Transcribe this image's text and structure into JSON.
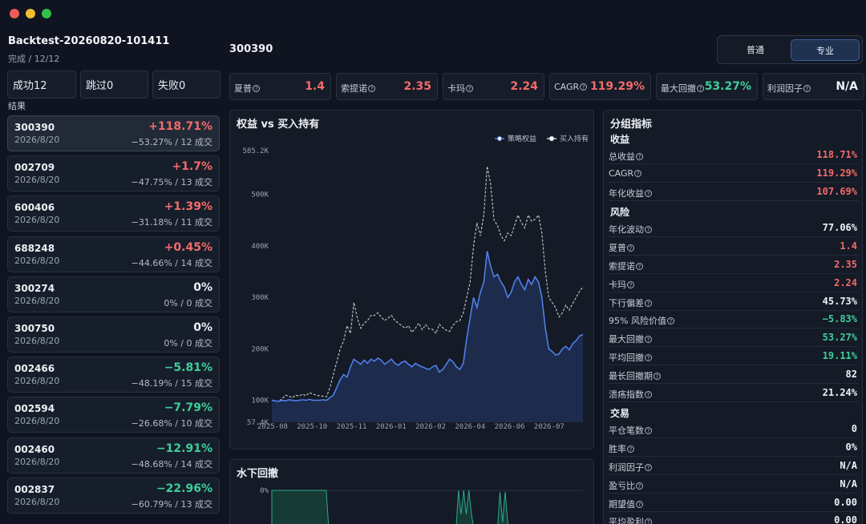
{
  "window": {
    "dots": [
      "#ee5c57",
      "#f2bd2f",
      "#32c048"
    ]
  },
  "sidebar": {
    "title": "Backtest-20260820-101411",
    "status": "完成 / 12/12",
    "stats": [
      {
        "label": "成功",
        "value": "12"
      },
      {
        "label": "跳过",
        "value": "0"
      },
      {
        "label": "失败",
        "value": "0"
      }
    ],
    "results_label": "结果",
    "results": [
      {
        "code": "300390",
        "date": "2026/8/20",
        "pct": "+118.71%",
        "sub": "−53.27% / 12 成交",
        "tone": "pos"
      },
      {
        "code": "002709",
        "date": "2026/8/20",
        "pct": "+1.7%",
        "sub": "−47.75% / 13 成交",
        "tone": "pos"
      },
      {
        "code": "600406",
        "date": "2026/8/20",
        "pct": "+1.39%",
        "sub": "−31.18% / 11 成交",
        "tone": "pos"
      },
      {
        "code": "688248",
        "date": "2026/8/20",
        "pct": "+0.45%",
        "sub": "−44.66% / 14 成交",
        "tone": "pos"
      },
      {
        "code": "300274",
        "date": "2026/8/20",
        "pct": "0%",
        "sub": "0% / 0 成交",
        "tone": "neu"
      },
      {
        "code": "300750",
        "date": "2026/8/20",
        "pct": "0%",
        "sub": "0% / 0 成交",
        "tone": "neu"
      },
      {
        "code": "002466",
        "date": "2026/8/20",
        "pct": "−5.81%",
        "sub": "−48.19% / 15 成交",
        "tone": "neg"
      },
      {
        "code": "002594",
        "date": "2026/8/20",
        "pct": "−7.79%",
        "sub": "−26.68% / 10 成交",
        "tone": "neg"
      },
      {
        "code": "002460",
        "date": "2026/8/20",
        "pct": "−12.91%",
        "sub": "−48.68% / 14 成交",
        "tone": "neg"
      },
      {
        "code": "002837",
        "date": "2026/8/20",
        "pct": "−22.96%",
        "sub": "−60.79% / 13 成交",
        "tone": "neg"
      }
    ]
  },
  "main": {
    "title": "300390",
    "modes": [
      "普通",
      "专业"
    ],
    "active_mode": "专业",
    "metrics": [
      {
        "label": "夏普",
        "value": "1.4",
        "tone": "pos"
      },
      {
        "label": "索提诺",
        "value": "2.35",
        "tone": "pos"
      },
      {
        "label": "卡玛",
        "value": "2.24",
        "tone": "pos"
      },
      {
        "label": "CAGR",
        "value": "119.29%",
        "tone": "pos"
      },
      {
        "label": "最大回撤",
        "value": "53.27%",
        "tone": "neg"
      },
      {
        "label": "利润因子",
        "value": "N/A",
        "tone": "neu"
      }
    ],
    "equity_chart_title": "权益 vs 买入持有",
    "drawdown_chart_title": "水下回撤"
  },
  "chart_data": [
    {
      "type": "line",
      "title": "权益 vs 买入持有",
      "legend": [
        "策略权益",
        "买入持有"
      ],
      "legend_position": "top-right",
      "y_ticks": [
        "585.2K",
        "500K",
        "400K",
        "300K",
        "200K",
        "100K",
        "57.4K"
      ],
      "ylim": [
        57400,
        585200
      ],
      "x_ticks": [
        "2025-08",
        "2025-10",
        "2025-11",
        "2026-01",
        "2026-02",
        "2026-04",
        "2026-06",
        "2026-07"
      ],
      "x_tick_pos": [
        0,
        0.127,
        0.254,
        0.381,
        0.508,
        0.635,
        0.762,
        0.889
      ],
      "colors": {
        "strategy": "#4f7fe8",
        "buyhold": "#c8ccd4"
      },
      "series": [
        {
          "name": "策略权益",
          "values": [
            100000,
            99000,
            98000,
            100000,
            99000,
            101000,
            100000,
            99000,
            100000,
            101000,
            100000,
            102000,
            100000,
            100000,
            100000,
            101000,
            100000,
            105000,
            110000,
            125000,
            140000,
            150000,
            145000,
            165000,
            180000,
            175000,
            170000,
            178000,
            172000,
            180000,
            176000,
            182000,
            178000,
            170000,
            175000,
            180000,
            172000,
            168000,
            174000,
            176000,
            170000,
            165000,
            172000,
            168000,
            165000,
            162000,
            160000,
            165000,
            168000,
            155000,
            160000,
            170000,
            180000,
            175000,
            165000,
            160000,
            172000,
            220000,
            260000,
            300000,
            280000,
            310000,
            330000,
            390000,
            360000,
            340000,
            345000,
            330000,
            320000,
            300000,
            310000,
            330000,
            340000,
            325000,
            315000,
            335000,
            325000,
            340000,
            330000,
            300000,
            240000,
            200000,
            195000,
            188000,
            190000,
            200000,
            205000,
            198000,
            210000,
            216000,
            225000,
            228000
          ]
        },
        {
          "name": "买入持有",
          "values": [
            100000,
            99000,
            98000,
            103000,
            110000,
            108000,
            105000,
            110000,
            108000,
            112000,
            109000,
            115000,
            112000,
            110000,
            109000,
            108000,
            107000,
            125000,
            150000,
            175000,
            200000,
            215000,
            245000,
            230000,
            290000,
            260000,
            240000,
            250000,
            255000,
            265000,
            265000,
            270000,
            262000,
            255000,
            260000,
            265000,
            255000,
            250000,
            245000,
            240000,
            245000,
            232000,
            240000,
            250000,
            237000,
            247000,
            239000,
            238000,
            230000,
            248000,
            241000,
            236000,
            234000,
            246000,
            253000,
            255000,
            270000,
            300000,
            330000,
            400000,
            445000,
            420000,
            460000,
            555000,
            520000,
            450000,
            440000,
            420000,
            410000,
            425000,
            420000,
            440000,
            460000,
            445000,
            435000,
            460000,
            448000,
            452000,
            460000,
            425000,
            350000,
            300000,
            290000,
            280000,
            262000,
            270000,
            285000,
            275000,
            288000,
            300000,
            312000,
            320000
          ]
        }
      ]
    },
    {
      "type": "area",
      "title": "水下回撤",
      "y_ticks": [
        "0%"
      ],
      "colors": {
        "drawdown": "#2ea88a"
      }
    }
  ],
  "groups": {
    "title": "分组指标",
    "sections": [
      {
        "name": "收益",
        "rows": [
          {
            "label": "总收益",
            "value": "118.71%",
            "tone": "pos"
          },
          {
            "label": "CAGR",
            "value": "119.29%",
            "tone": "pos"
          },
          {
            "label": "年化收益",
            "value": "107.69%",
            "tone": "pos"
          }
        ]
      },
      {
        "name": "风险",
        "rows": [
          {
            "label": "年化波动",
            "value": "77.06%",
            "tone": "neu"
          },
          {
            "label": "夏普",
            "value": "1.4",
            "tone": "pos"
          },
          {
            "label": "索提诺",
            "value": "2.35",
            "tone": "pos"
          },
          {
            "label": "卡玛",
            "value": "2.24",
            "tone": "pos"
          },
          {
            "label": "下行偏差",
            "value": "45.73%",
            "tone": "neu"
          },
          {
            "label": "95% 风险价值",
            "value": "−5.83%",
            "tone": "neg"
          },
          {
            "label": "最大回撤",
            "value": "53.27%",
            "tone": "neg"
          },
          {
            "label": "平均回撤",
            "value": "19.11%",
            "tone": "neg"
          },
          {
            "label": "最长回撤期",
            "value": "82",
            "tone": "neu"
          },
          {
            "label": "溃疡指数",
            "value": "21.24%",
            "tone": "neu"
          }
        ]
      },
      {
        "name": "交易",
        "rows": [
          {
            "label": "平仓笔数",
            "value": "0",
            "tone": "neu"
          },
          {
            "label": "胜率",
            "value": "0%",
            "tone": "neu"
          },
          {
            "label": "利润因子",
            "value": "N/A",
            "tone": "neu"
          },
          {
            "label": "盈亏比",
            "value": "N/A",
            "tone": "neu"
          },
          {
            "label": "期望值",
            "value": "0.00",
            "tone": "neu"
          },
          {
            "label": "平均盈利",
            "value": "0.00",
            "tone": "neu"
          }
        ]
      }
    ]
  }
}
